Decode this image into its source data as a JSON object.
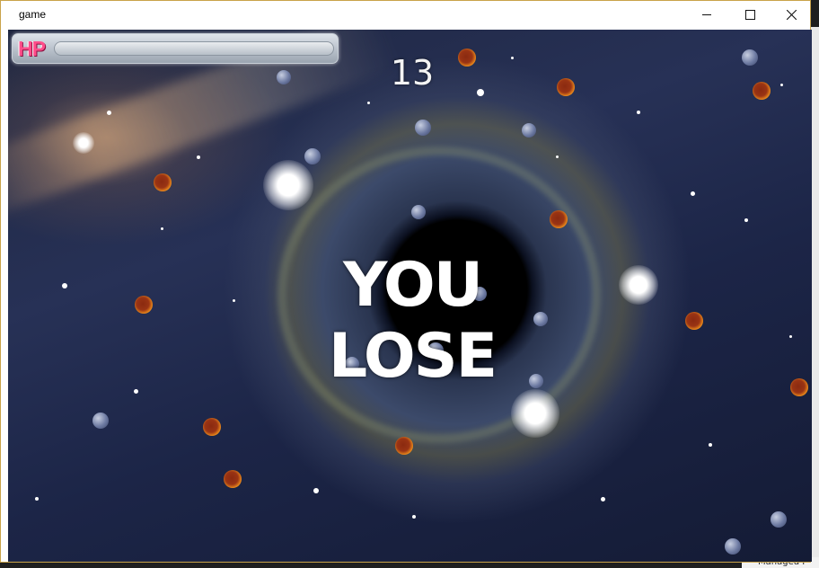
{
  "window": {
    "title": "game"
  },
  "hud": {
    "hp_label": "HP",
    "hp_fraction": 0.0,
    "score": "13"
  },
  "overlay": {
    "message": "YOU LOSE"
  },
  "desktop": {
    "partial_text": "Managed I"
  },
  "colors": {
    "hp_label": "#ff4d8a",
    "message": "#ffffff"
  }
}
